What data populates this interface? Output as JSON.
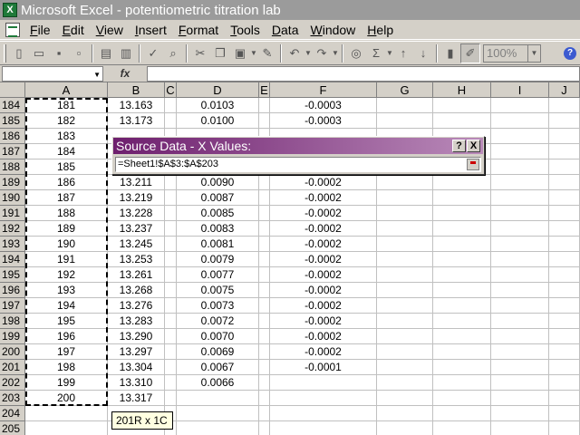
{
  "window": {
    "title": "Microsoft Excel - potentiometric titration lab"
  },
  "menu": [
    {
      "label": "File",
      "name": "menu-file"
    },
    {
      "label": "Edit",
      "name": "menu-edit"
    },
    {
      "label": "View",
      "name": "menu-view"
    },
    {
      "label": "Insert",
      "name": "menu-insert"
    },
    {
      "label": "Format",
      "name": "menu-format"
    },
    {
      "label": "Tools",
      "name": "menu-tools"
    },
    {
      "label": "Data",
      "name": "menu-data"
    },
    {
      "label": "Window",
      "name": "menu-window"
    },
    {
      "label": "Help",
      "name": "menu-help"
    }
  ],
  "toolbar": {
    "zoom": "100%",
    "icons": [
      "new-icon",
      "open-icon",
      "save-icon",
      "permission-icon",
      "print-icon",
      "print-preview-icon",
      "spelling-icon",
      "research-icon",
      "cut-icon",
      "copy-icon",
      "paste-icon",
      "format-painter-icon",
      "undo-icon",
      "redo-icon",
      "hyperlink-icon",
      "autosum-icon",
      "sort-ascending-icon",
      "sort-descending-icon",
      "chart-wizard-icon",
      "drawing-icon"
    ]
  },
  "formula_bar": {
    "fx": "fx",
    "name_box": "",
    "content": ""
  },
  "columns": [
    "A",
    "B",
    "C",
    "D",
    "E",
    "F",
    "G",
    "H",
    "I",
    "J"
  ],
  "rows": [
    {
      "num": "184",
      "A": "181",
      "B": "13.163",
      "D": "0.0103",
      "F": "-0.0003"
    },
    {
      "num": "185",
      "A": "182",
      "B": "13.173",
      "D": "0.0100",
      "F": "-0.0003"
    },
    {
      "num": "186",
      "A": "183",
      "B": "",
      "D": "",
      "F": ""
    },
    {
      "num": "187",
      "A": "184",
      "B": "",
      "D": "",
      "F": ""
    },
    {
      "num": "188",
      "A": "185",
      "B": "",
      "D": "",
      "F": ""
    },
    {
      "num": "189",
      "A": "186",
      "B": "13.211",
      "D": "0.0090",
      "F": "-0.0002"
    },
    {
      "num": "190",
      "A": "187",
      "B": "13.219",
      "D": "0.0087",
      "F": "-0.0002"
    },
    {
      "num": "191",
      "A": "188",
      "B": "13.228",
      "D": "0.0085",
      "F": "-0.0002"
    },
    {
      "num": "192",
      "A": "189",
      "B": "13.237",
      "D": "0.0083",
      "F": "-0.0002"
    },
    {
      "num": "193",
      "A": "190",
      "B": "13.245",
      "D": "0.0081",
      "F": "-0.0002"
    },
    {
      "num": "194",
      "A": "191",
      "B": "13.253",
      "D": "0.0079",
      "F": "-0.0002"
    },
    {
      "num": "195",
      "A": "192",
      "B": "13.261",
      "D": "0.0077",
      "F": "-0.0002"
    },
    {
      "num": "196",
      "A": "193",
      "B": "13.268",
      "D": "0.0075",
      "F": "-0.0002"
    },
    {
      "num": "197",
      "A": "194",
      "B": "13.276",
      "D": "0.0073",
      "F": "-0.0002"
    },
    {
      "num": "198",
      "A": "195",
      "B": "13.283",
      "D": "0.0072",
      "F": "-0.0002"
    },
    {
      "num": "199",
      "A": "196",
      "B": "13.290",
      "D": "0.0070",
      "F": "-0.0002"
    },
    {
      "num": "200",
      "A": "197",
      "B": "13.297",
      "D": "0.0069",
      "F": "-0.0002"
    },
    {
      "num": "201",
      "A": "198",
      "B": "13.304",
      "D": "0.0067",
      "F": "-0.0001"
    },
    {
      "num": "202",
      "A": "199",
      "B": "13.310",
      "D": "0.0066",
      "F": ""
    },
    {
      "num": "203",
      "A": "200",
      "B": "13.317",
      "D": "",
      "F": ""
    },
    {
      "num": "204",
      "A": "",
      "B": "",
      "D": "",
      "F": ""
    },
    {
      "num": "205",
      "A": "",
      "B": "",
      "D": "",
      "F": ""
    }
  ],
  "dialog": {
    "title": "Source Data - X Values:",
    "help": "?",
    "close": "X",
    "range": "=Sheet1!$A$3:$A$203"
  },
  "tooltip": "201R x 1C",
  "colors": {
    "dialog_title_start": "#6e1f6e",
    "dialog_title_end": "#b98ab9",
    "titlebar": "#9b9b9b"
  }
}
